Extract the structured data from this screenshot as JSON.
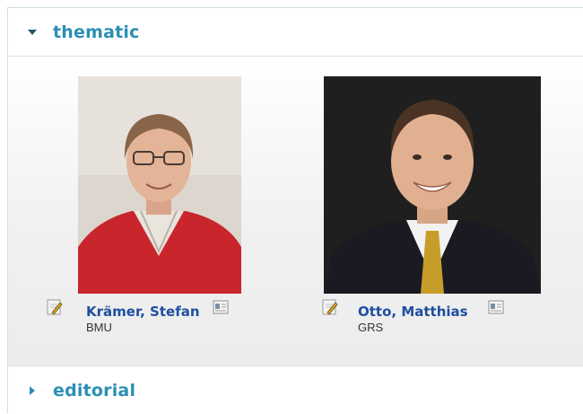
{
  "sections": {
    "thematic": {
      "title": "thematic",
      "state": "expanded",
      "arrow_icon": "triangle-down-icon"
    },
    "editorial": {
      "title": "editorial",
      "state": "collapsed",
      "arrow_icon": "triangle-right-icon"
    }
  },
  "people": [
    {
      "name": "Krämer, Stefan",
      "org": "BMU",
      "edit_icon": "edit-icon",
      "vcard_icon": "vcard-icon"
    },
    {
      "name": "Otto, Matthias",
      "org": "GRS",
      "edit_icon": "edit-icon",
      "vcard_icon": "vcard-icon"
    }
  ],
  "colors": {
    "accent": "#2b8fb4",
    "name_link": "#1f4fa0"
  }
}
